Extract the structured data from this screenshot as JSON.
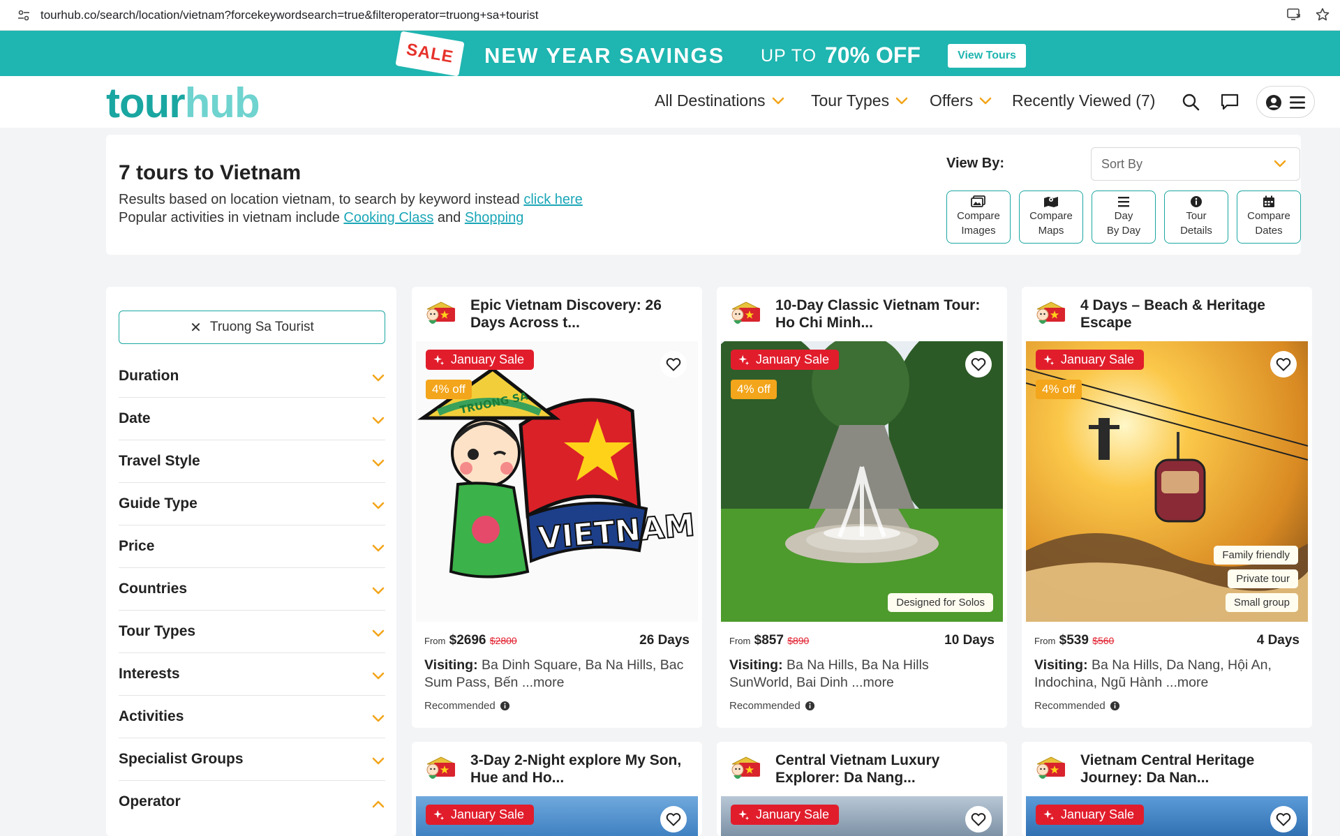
{
  "browser": {
    "url": "tourhub.co/search/location/vietnam?forcekeywordsearch=true&filteroperator=truong+sa+tourist"
  },
  "banner": {
    "sale_tag": "SALE",
    "title": "NEW YEAR SAVINGS",
    "upto": "UP TO",
    "percent": "70% OFF",
    "button": "View Tours"
  },
  "header": {
    "logo_part1": "tour",
    "logo_part2": "hub",
    "nav": [
      "All Destinations",
      "Tour Types",
      "Offers",
      "Recently Viewed (7)"
    ]
  },
  "summary": {
    "title": "7 tours to Vietnam",
    "line1_text": "Results based on location vietnam, to search by keyword instead ",
    "line1_link": "click here",
    "line2_text": "Popular activities in vietnam include ",
    "line2_link1": "Cooking Class",
    "line2_and": " and ",
    "line2_link2": "Shopping",
    "view_by": "View By:",
    "sort_by": "Sort By",
    "view_buttons": [
      {
        "line1": "Compare",
        "line2": "Images"
      },
      {
        "line1": "Compare",
        "line2": "Maps"
      },
      {
        "line1": "Day",
        "line2": "By Day"
      },
      {
        "line1": "Tour",
        "line2": "Details"
      },
      {
        "line1": "Compare",
        "line2": "Dates"
      }
    ]
  },
  "filters": {
    "active_chip": "Truong Sa Tourist",
    "items": [
      "Duration",
      "Date",
      "Travel Style",
      "Guide Type",
      "Price",
      "Countries",
      "Tour Types",
      "Interests",
      "Activities",
      "Specialist Groups",
      "Operator"
    ]
  },
  "cards": [
    {
      "title": "Epic Vietnam Discovery: 26 Days Across t...",
      "sale": "January Sale",
      "off": "4% off",
      "from": "From",
      "price": "$2696",
      "old_price": "$2800",
      "days": "26 Days",
      "visiting_label": "Visiting:",
      "visiting": "Ba Dinh Square, Ba Na Hills, Bac Sum Pass, Bến ...more",
      "recommended": "Recommended",
      "image_text": "VIETNAM",
      "hat_text": "TRUONG SA"
    },
    {
      "title": "10-Day Classic Vietnam Tour: Ho Chi Minh...",
      "sale": "January Sale",
      "off": "4% off",
      "from": "From",
      "price": "$857",
      "old_price": "$890",
      "days": "10 Days",
      "visiting_label": "Visiting:",
      "visiting": "Ba Na Hills, Ba Na Hills SunWorld, Bai Dinh ...more",
      "recommended": "Recommended",
      "tags": [
        "Designed for Solos"
      ]
    },
    {
      "title": "4 Days – Beach & Heritage Escape",
      "sale": "January Sale",
      "off": "4% off",
      "from": "From",
      "price": "$539",
      "old_price": "$560",
      "days": "4 Days",
      "visiting_label": "Visiting:",
      "visiting": "Ba Na Hills, Da Nang, Hội An, Indochina, Ngũ Hành ...more",
      "recommended": "Recommended",
      "tags": [
        "Family friendly",
        "Private tour",
        "Small group"
      ]
    },
    {
      "title": "3-Day 2-Night explore My Son, Hue and Ho...",
      "sale": "January Sale"
    },
    {
      "title": "Central Vietnam Luxury Explorer: Da Nang...",
      "sale": "January Sale"
    },
    {
      "title": "Vietnam Central Heritage Journey: Da Nan...",
      "sale": "January Sale"
    }
  ],
  "colors": {
    "teal": "#1fb5b0",
    "sale_red": "#e11d2c",
    "discount_orange": "#f3a51b",
    "chevron_orange": "#f3a51b"
  }
}
